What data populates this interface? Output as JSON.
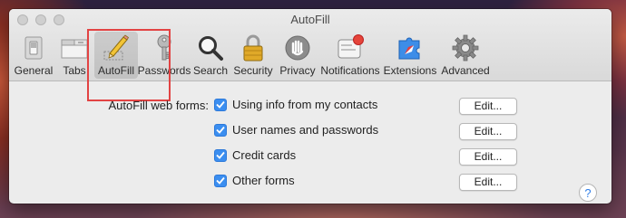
{
  "window": {
    "title": "AutoFill"
  },
  "toolbar": {
    "items": [
      {
        "label": "General",
        "icon": "switch-icon"
      },
      {
        "label": "Tabs",
        "icon": "tabs-icon"
      },
      {
        "label": "AutoFill",
        "icon": "pencil-icon",
        "selected": true
      },
      {
        "label": "Passwords",
        "icon": "key-icon"
      },
      {
        "label": "Search",
        "icon": "magnifier-icon"
      },
      {
        "label": "Security",
        "icon": "lock-icon"
      },
      {
        "label": "Privacy",
        "icon": "hand-icon"
      },
      {
        "label": "Notifications",
        "icon": "notifications-icon"
      },
      {
        "label": "Extensions",
        "icon": "puzzle-icon"
      },
      {
        "label": "Advanced",
        "icon": "gear-icon"
      }
    ]
  },
  "autofill": {
    "label": "AutoFill web forms:",
    "options": [
      {
        "label": "Using info from my contacts",
        "checked": true,
        "button": "Edit..."
      },
      {
        "label": "User names and passwords",
        "checked": true,
        "button": "Edit..."
      },
      {
        "label": "Credit cards",
        "checked": true,
        "button": "Edit..."
      },
      {
        "label": "Other forms",
        "checked": true,
        "button": "Edit..."
      }
    ]
  },
  "help": {
    "label": "?"
  },
  "colors": {
    "accent": "#3b8ef0",
    "highlight_box": "#e24343"
  }
}
